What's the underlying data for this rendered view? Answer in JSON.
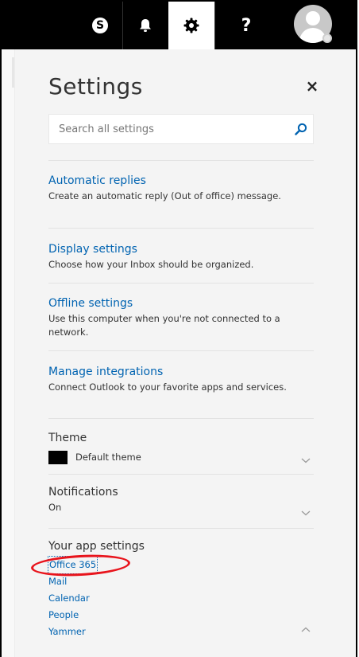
{
  "topbar": {
    "skype_glyph": "S",
    "help_glyph": "?",
    "icons": [
      "skype-icon",
      "bell-icon",
      "gear-icon",
      "help-icon",
      "avatar"
    ]
  },
  "settings": {
    "title": "Settings",
    "close_glyph": "×",
    "search_placeholder": "Search all settings"
  },
  "options": [
    {
      "link": "Automatic replies",
      "desc": "Create an automatic reply (Out of office) message."
    },
    {
      "link": "Display settings",
      "desc": "Choose how your Inbox should be organized."
    },
    {
      "link": "Offline settings",
      "desc": "Use this computer when you're not connected to a network."
    },
    {
      "link": "Manage integrations",
      "desc": "Connect Outlook to your favorite apps and services."
    }
  ],
  "theme": {
    "heading": "Theme",
    "value": "Default theme"
  },
  "notifications": {
    "heading": "Notifications",
    "value": "On"
  },
  "app_settings": {
    "heading": "Your app settings",
    "apps": [
      "Office 365",
      "Mail",
      "Calendar",
      "People",
      "Yammer"
    ]
  },
  "colors": {
    "link": "#0063b1",
    "topbar": "#000000",
    "panel": "#f4f4f4",
    "annotation": "#e8141c"
  }
}
